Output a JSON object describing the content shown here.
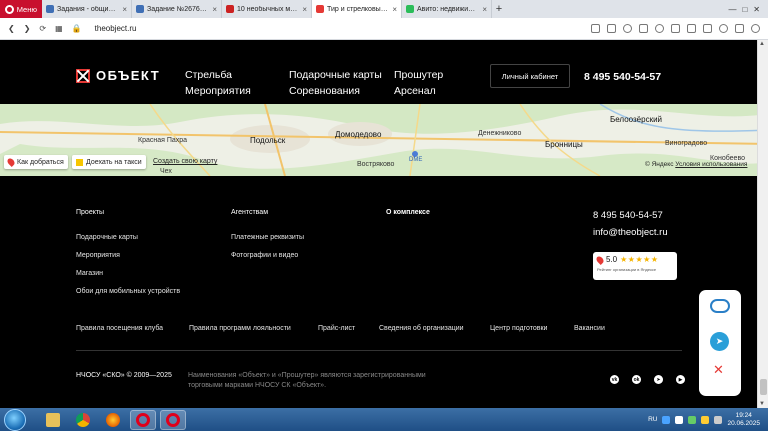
{
  "browser": {
    "menu_label": "Меню",
    "tabs": [
      {
        "title": "Задания - общий список",
        "active": false,
        "favicon_color": "#3f6fb5"
      },
      {
        "title": "Задание №2676760 - про",
        "active": false,
        "favicon_color": "#3f6fb5"
      },
      {
        "title": "10 необычных мест для с",
        "active": false,
        "favicon_color": "#cc2222"
      },
      {
        "title": "Тир и стрелковый клуб в",
        "active": true,
        "favicon_color": "#e53935"
      },
      {
        "title": "Авито: недвижимость, тра",
        "active": false,
        "favicon_color": "#2bbd5a"
      }
    ],
    "url": "theobject.ru"
  },
  "header": {
    "logo_text": "ОБЪЕКТ",
    "nav_col1": [
      "Стрельба",
      "Мероприятия"
    ],
    "nav_col2": [
      "Подарочные карты",
      "Соревнования"
    ],
    "nav_col3": [
      "Прошутер",
      "Арсенал"
    ],
    "cabinet_label": "Личный кабинет",
    "phone": "8 495 540-54-57"
  },
  "map": {
    "labels": {
      "krasnaya_pakhra": "Красная Пахра",
      "podolsk": "Подольск",
      "domodedovo": "Домодедово",
      "denezhnikovo": "Денежниково",
      "belooziorsky": "Белоозёрский",
      "bronnitsy": "Бронницы",
      "vinogradovo": "Виноградово",
      "konobeevo": "Конобеево",
      "vostryakovo": "Востряково",
      "dme": "DME",
      "chekh": "Чех"
    },
    "how_to_get_label": "Как добраться",
    "taxi_label": "Доехать на такси",
    "create_map_label": "Создать свою карту",
    "copyright": "© Яндекс",
    "terms_label": "Условия использования"
  },
  "footer": {
    "col1_title": "Проекты",
    "col1_links": [
      "Подарочные карты",
      "Мероприятия",
      "Магазин",
      "Обои для мобильных устройств"
    ],
    "col2_title": "Агентствам",
    "col2_links": [
      "Платежные реквизиты",
      "Фотографии и видео"
    ],
    "col3_title": "О комплексе",
    "phone": "8 495 540-54-57",
    "email": "info@theobject.ru",
    "rating": {
      "value": "5.0",
      "stars": 5,
      "caption": "Рейтинг организации в Яндексе"
    },
    "bottom_links": [
      "Правила посещения клуба",
      "Правила программ лояльности",
      "Прайс-лист",
      "Сведения об организации",
      "Центр подготовки",
      "Вакансии"
    ],
    "copyright": "НЧОСУ «СКО» © 2009—2025",
    "legal": "Наименования «Объект» и «Прошутер» являются зарегистрированными торговыми марками НЧОСУ СК «Объект».",
    "socials": [
      "vk-icon",
      "ok-icon",
      "telegram-icon",
      "youtube-icon"
    ]
  },
  "taskbar": {
    "lang": "RU",
    "time": "19:24",
    "date": "20.06.2025"
  }
}
